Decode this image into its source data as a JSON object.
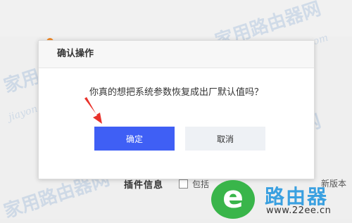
{
  "dialog": {
    "title": "确认操作",
    "message": "你真的想把系统参数恢复成出厂默认值吗？",
    "confirm_label": "确定",
    "cancel_label": "取消"
  },
  "background": {
    "plugin_label": "插件信息",
    "plugin_option": "包括",
    "right_text": "新版本"
  },
  "watermark": {
    "text_cn": "家用路由器网",
    "text_url": "jiayongluyou.com"
  },
  "logo": {
    "letter": "e",
    "name": "路由器",
    "url": "www.22ee.cn"
  },
  "colors": {
    "primary_button": "#3f5ff5",
    "cancel_button": "#eef1f5",
    "arrow": "#e8322b",
    "logo_green": "#39b54a",
    "logo_blue": "#3aa0e0"
  },
  "icons": {
    "annotation": "red-arrow-icon"
  }
}
